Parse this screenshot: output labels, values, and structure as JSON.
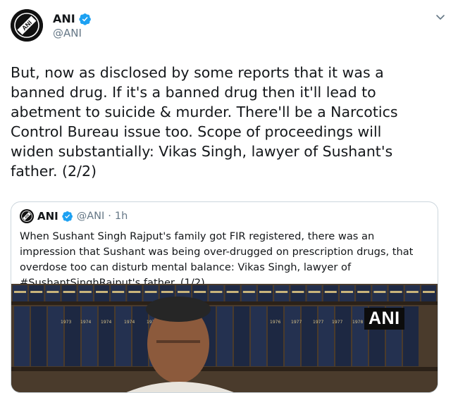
{
  "author": {
    "name": "ANI",
    "handle": "@ANI",
    "avatar_icon": "ani-logo-icon",
    "verified_icon": "verified-badge-icon"
  },
  "menu_icon": "chevron-down-icon",
  "tweet": {
    "text": "But, now as disclosed by some reports that it was a\nbanned drug. If it's a banned drug then it'll lead to\nabetment to suicide & murder. There'll be a Narcotics\nControl Bureau issue too. Scope of proceedings will\nwiden substantially: Vikas Singh, lawyer of Sushant's\nfather. (2/2)"
  },
  "quoted_tweet": {
    "name": "ANI",
    "handle": "@ANI",
    "separator": "·",
    "time": "1h",
    "text": "When Sushant Singh Rajput's family got FIR registered, there was an impression that Sushant was being over-drugged on prescription drugs, that overdose too can disturb mental balance: Vikas Singh, lawyer of #SushantSinghRajput's father. (1/2)",
    "media": {
      "watermark": "ANI",
      "book_spine_labels": [
        "1973",
        "1974",
        "1974",
        "1974",
        "1974",
        "1975",
        "1976",
        "1977",
        "1977",
        "1977",
        "1978"
      ]
    }
  },
  "colors": {
    "text": "#14171a",
    "muted": "#657786",
    "verified": "#1da1f2",
    "border": "#ccd6dd"
  }
}
